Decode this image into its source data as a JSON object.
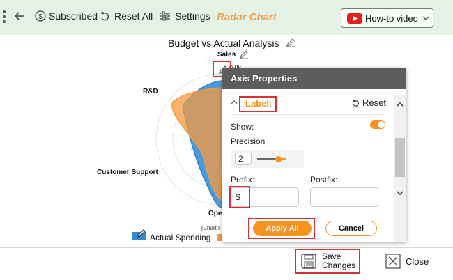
{
  "toolbar": {
    "subscribed_label": "Subscribed",
    "reset_all_label": "Reset All",
    "settings_label": "Settings",
    "radar_chart_label": "Radar Chart",
    "howto_label": "How-to video"
  },
  "chart": {
    "title": "Budget vs Actual Analysis",
    "axes": [
      "Sales",
      "R&D",
      "Customer Support",
      "Ope"
    ],
    "tick_top": "0.0k",
    "footnote": "[Chart F",
    "legend": [
      "Actual Spending"
    ]
  },
  "chart_data": {
    "type": "radar",
    "title": "Budget vs Actual Analysis",
    "categories": [
      "Sales",
      "R&D",
      "Customer Support",
      "Ope"
    ],
    "series": [
      {
        "name": "Actual Spending",
        "values": [
          0.75,
          0.8,
          0.35,
          0.75
        ]
      }
    ],
    "legend": "bottom"
  },
  "panel": {
    "title": "Axis Properties",
    "section_label": "Label:",
    "reset_label": "Reset",
    "show_label": "Show:",
    "show_on": true,
    "precision_label": "Precision",
    "precision_value": "2",
    "prefix_label": "Prefix:",
    "prefix_value": "$",
    "postfix_label": "Postfix:",
    "postfix_value": "",
    "apply_label": "Apply All",
    "cancel_label": "Cancel"
  },
  "footer": {
    "save_line1": "Save",
    "save_line2": "Changes",
    "close_label": "Close"
  },
  "colors": {
    "toolbar_bg": "#e3f2e5",
    "accent_orange": "#f7931e",
    "radar_title": "#f5a04a",
    "highlight_red": "#d9312f",
    "series_actual": "#2e88d3",
    "series_orange": "#f79a3e"
  }
}
